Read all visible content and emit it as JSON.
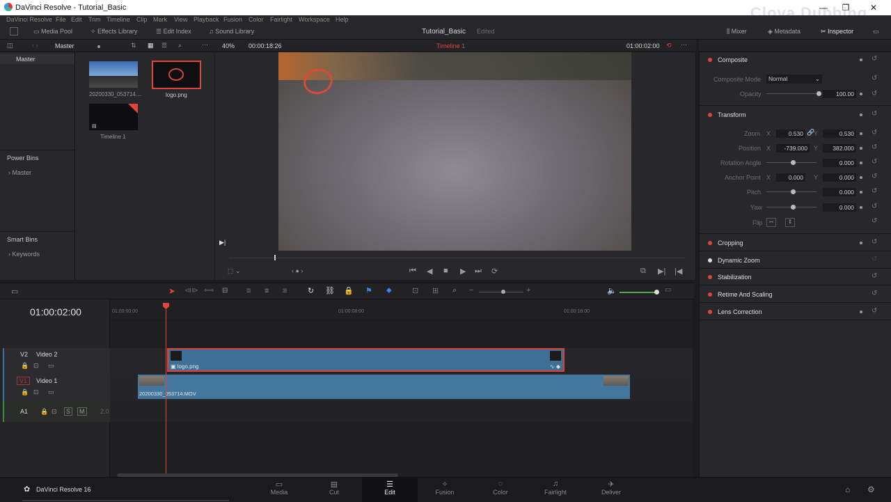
{
  "window": {
    "title": "DaVinci Resolve - Tutorial_Basic",
    "minimize": "—",
    "maximize": "❐",
    "close": "✕"
  },
  "watermark": "Clova Dubbing",
  "menu": [
    "DaVinci Resolve",
    "File",
    "Edit",
    "Trim",
    "Timeline",
    "Clip",
    "Mark",
    "View",
    "Playback",
    "Fusion",
    "Color",
    "Fairlight",
    "Workspace",
    "Help"
  ],
  "toolbar": {
    "media_pool": "Media Pool",
    "effects_library": "Effects Library",
    "edit_index": "Edit Index",
    "sound_library": "Sound Library",
    "project_name": "Tutorial_Basic",
    "project_status": "Edited",
    "mixer": "Mixer",
    "metadata": "Metadata",
    "inspector": "Inspector"
  },
  "pool_bar": {
    "bin": "Master",
    "zoom": "40%",
    "source_tc": "00:00:18:26",
    "timeline": "Timeline 1",
    "record_tc": "01:00:02:00"
  },
  "bins": {
    "master": "Master",
    "power_bins": "Power Bins",
    "power_master": "Master",
    "smart_bins": "Smart Bins",
    "keywords": "Keywords"
  },
  "media": [
    {
      "name": "20200330_053714....",
      "kind": "video"
    },
    {
      "name": "logo.png",
      "kind": "image"
    },
    {
      "name": "Timeline 1",
      "kind": "timeline"
    }
  ],
  "timeline": {
    "timecode": "01:00:02:00",
    "ruler": [
      "01:00:00:00",
      "01:00:08:00",
      "01:00:16:00"
    ],
    "tracks": [
      {
        "id": "V2",
        "name": "Video 2"
      },
      {
        "id": "V1",
        "name": "Video 1"
      },
      {
        "id": "A1",
        "name": "",
        "level": "2.0"
      }
    ],
    "clip_v2": "logo.png",
    "clip_v1": "20200330_053714.MOV"
  },
  "inspector": {
    "composite": {
      "title": "Composite",
      "mode_label": "Composite Mode",
      "mode_value": "Normal",
      "opacity_label": "Opacity",
      "opacity_value": "100.00"
    },
    "transform": {
      "title": "Transform",
      "zoom_label": "Zoom",
      "zoom_x": "0.530",
      "zoom_y": "0.530",
      "position_label": "Position",
      "position_x": "-739.000",
      "position_y": "382.000",
      "rotation_label": "Rotation Angle",
      "rotation_value": "0.000",
      "anchor_label": "Anchor Point",
      "anchor_x": "0.000",
      "anchor_y": "0.000",
      "pitch_label": "Pitch",
      "pitch_value": "0.000",
      "yaw_label": "Yaw",
      "yaw_value": "0.000",
      "flip_label": "Flip",
      "x": "X",
      "y": "Y"
    },
    "sections": [
      "Cropping",
      "Dynamic Zoom",
      "Stabilization",
      "Retime And Scaling",
      "Lens Correction"
    ]
  },
  "pages": [
    "Media",
    "Cut",
    "Edit",
    "Fusion",
    "Color",
    "Fairlight",
    "Deliver"
  ],
  "active_page": "Edit",
  "brand": "DaVinci Resolve 16",
  "colors": {
    "accent_red": "#e0453a",
    "clip_blue": "#44779d",
    "playhead": "#e0453a"
  }
}
